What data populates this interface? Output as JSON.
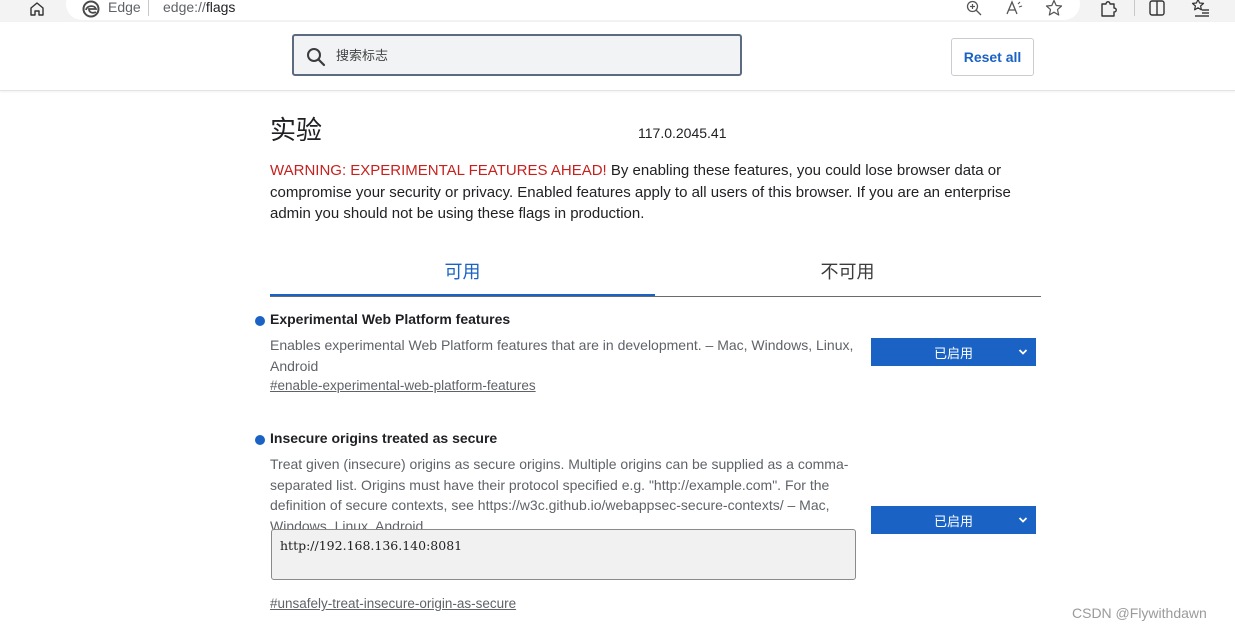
{
  "browser": {
    "site_name": "Edge",
    "url_prefix": "edge://",
    "url_path": "flags"
  },
  "header": {
    "search_placeholder": "搜索标志",
    "reset_label": "Reset all"
  },
  "page": {
    "title": "实验",
    "version": "117.0.2045.41",
    "warning_strong": "WARNING: EXPERIMENTAL FEATURES AHEAD!",
    "warning_text": " By enabling these features, you could lose browser data or compromise your security or privacy. Enabled features apply to all users of this browser. If you are an enterprise admin you should not be using these flags in production."
  },
  "tabs": [
    {
      "label": "可用",
      "active": true
    },
    {
      "label": "不可用",
      "active": false
    }
  ],
  "flags": [
    {
      "title": "Experimental Web Platform features",
      "description": "Enables experimental Web Platform features that are in development. – Mac, Windows, Linux, Android",
      "link": "#enable-experimental-web-platform-features",
      "state": "已启用"
    },
    {
      "title": "Insecure origins treated as secure",
      "description": "Treat given (insecure) origins as secure origins. Multiple origins can be supplied as a comma-separated list. Origins must have their protocol specified e.g. \"http://example.com\". For the definition of secure contexts, see https://w3c.github.io/webappsec-secure-contexts/ – Mac, Windows, Linux, Android",
      "input_value": "http://192.168.136.140:8081",
      "link": "#unsafely-treat-insecure-origin-as-secure",
      "state": "已启用"
    }
  ],
  "colors": {
    "accent": "#1a62c4",
    "warning": "#c5221f"
  },
  "watermark": "CSDN @Flywithdawn"
}
